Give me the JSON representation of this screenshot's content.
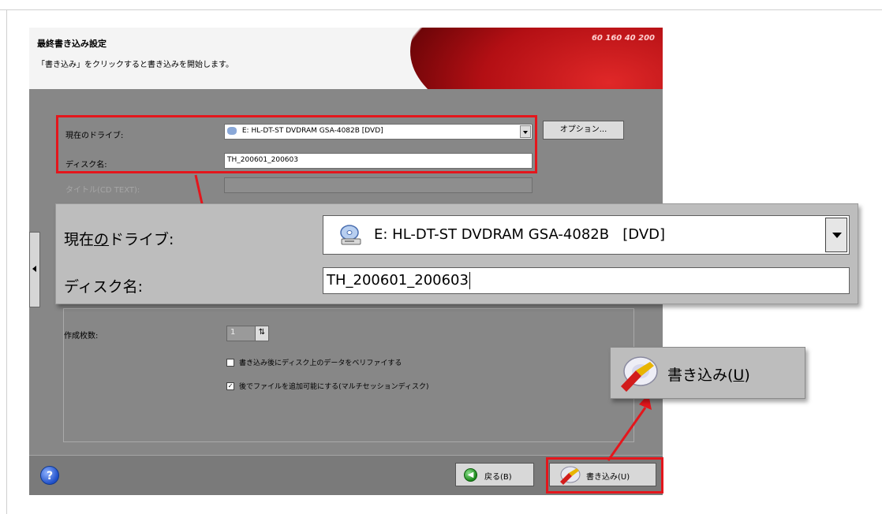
{
  "wizard": {
    "title": "最終書き込み設定",
    "subtitle": "「書き込み」をクリックすると書き込みを開始します。",
    "header_gauge": "60 160 40 200"
  },
  "settings": {
    "drive_label": "現在のドライブ:",
    "drive_value": "E: HL-DT-ST DVDRAM GSA-4082B  [DVD]",
    "options_button": "オプション...",
    "disc_name_label": "ディスク名:",
    "disc_name_value": "TH_200601_200603",
    "cdtext_label": "タイトル(CD TEXT):"
  },
  "copies": {
    "label": "作成枚数:",
    "value": "1"
  },
  "checkboxes": [
    {
      "label": "書き込み後にディスク上のデータをベリファイする",
      "checked": false,
      "mark": ""
    },
    {
      "label": "後でファイルを追加可能にする(マルチセッションディスク)",
      "checked": true,
      "mark": "✓"
    }
  ],
  "bottom": {
    "help": "?",
    "back_label": "戻る(B)",
    "write_label": "書き込み(U)"
  },
  "zoom": {
    "drive_label_pre": "現在",
    "drive_label_ul": "の",
    "drive_label_post": "ドライブ:",
    "drive_value": "E: HL-DT-ST DVDRAM GSA-4082B   [DVD]",
    "disc_name_label": "ディスク名:",
    "disc_name_value": "TH_200601_200603"
  },
  "callout": {
    "write_pre": "書き込み(",
    "write_ul": "U",
    "write_post": ")"
  },
  "colors": {
    "highlight": "#e4161c",
    "window_bg": "#878787"
  }
}
